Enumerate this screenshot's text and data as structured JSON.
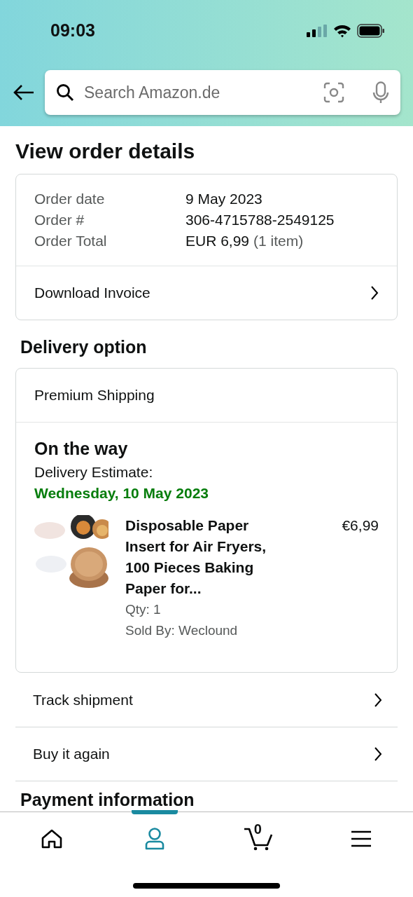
{
  "status_bar": {
    "time": "09:03"
  },
  "search": {
    "placeholder": "Search Amazon.de"
  },
  "title": "View order details",
  "order_summary": {
    "rows": [
      {
        "label": "Order date",
        "value": "9 May 2023"
      },
      {
        "label": "Order #",
        "value": "306-4715788-2549125"
      },
      {
        "label": "Order Total",
        "value": "EUR 6,99",
        "note": "(1 item)"
      }
    ],
    "link": "Download Invoice"
  },
  "delivery": {
    "heading": "Delivery option",
    "method": "Premium Shipping",
    "status": "On the way",
    "estimate_label": "Delivery Estimate:",
    "estimate_date": "Wednesday, 10 May 2023",
    "item": {
      "title": "Disposable Paper Insert for Air Fryers, 100 Pieces Baking Paper for...",
      "price": "€6,99",
      "qty": "Qty: 1",
      "seller": "Sold By: Weclound"
    }
  },
  "actions": [
    "Track shipment",
    "Buy it again"
  ],
  "next_heading": "Payment information",
  "bottom_nav": [
    {
      "kind": "home",
      "selected": false
    },
    {
      "kind": "account",
      "selected": true
    },
    {
      "kind": "cart",
      "selected": false,
      "count": "0"
    },
    {
      "kind": "menu",
      "selected": false
    }
  ]
}
